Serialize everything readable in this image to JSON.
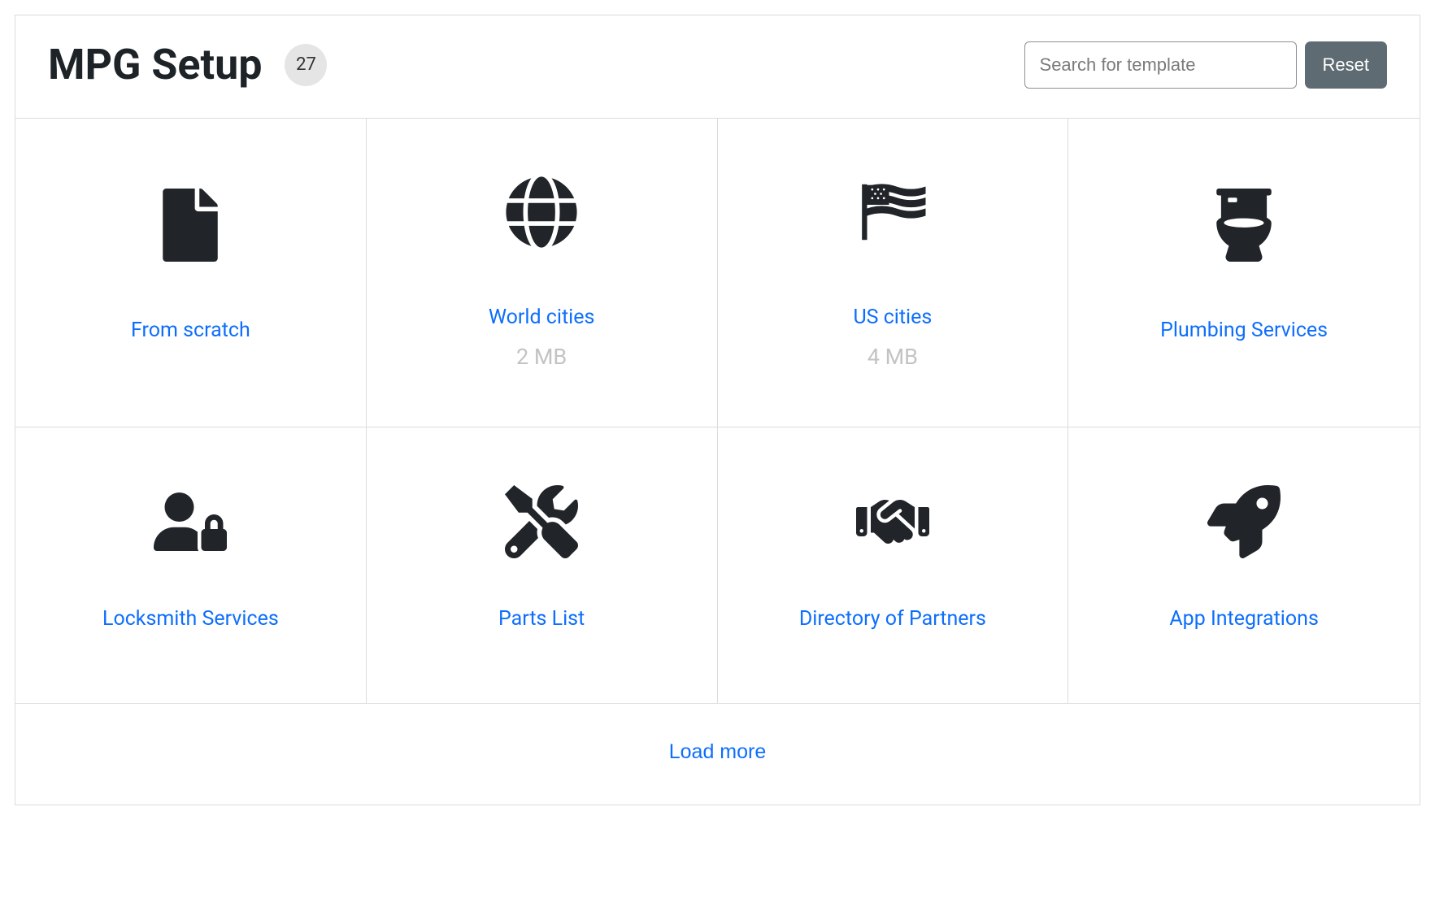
{
  "header": {
    "title": "MPG Setup",
    "badge_count": "27",
    "search_placeholder": "Search for template",
    "reset_label": "Reset"
  },
  "cards": [
    {
      "title": "From scratch",
      "sub": "",
      "icon": "file"
    },
    {
      "title": "World cities",
      "sub": "2 MB",
      "icon": "globe"
    },
    {
      "title": "US cities",
      "sub": "4 MB",
      "icon": "flag"
    },
    {
      "title": "Plumbing Services",
      "sub": "",
      "icon": "toilet"
    },
    {
      "title": "Locksmith Services",
      "sub": "",
      "icon": "userlock"
    },
    {
      "title": "Parts List",
      "sub": "",
      "icon": "tools"
    },
    {
      "title": "Directory of Partners",
      "sub": "",
      "icon": "handshake"
    },
    {
      "title": "App Integrations",
      "sub": "",
      "icon": "rocket"
    }
  ],
  "footer": {
    "load_more_label": "Load more"
  }
}
